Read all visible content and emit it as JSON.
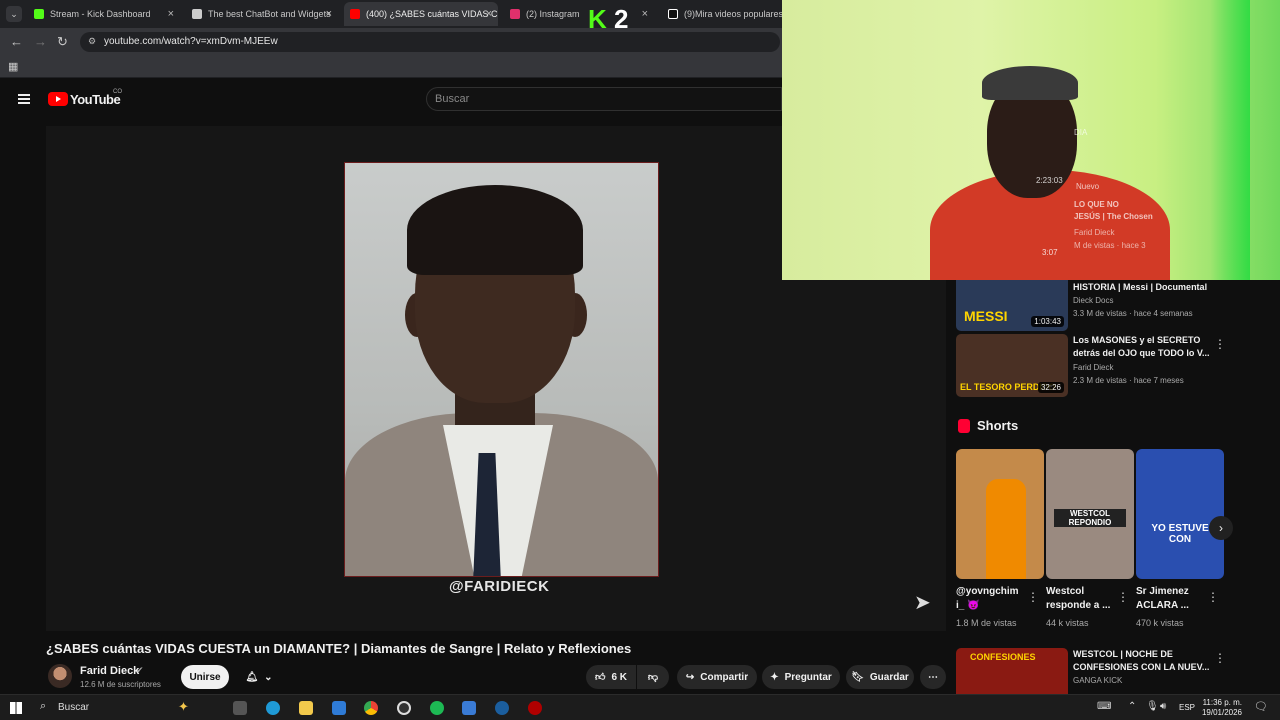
{
  "browser": {
    "tabs": [
      {
        "label": "Stream - Kick Dashboard",
        "color": "#53fc18"
      },
      {
        "label": "The best ChatBot and Widgets",
        "color": "#cccccc"
      },
      {
        "label": "(400) ¿SABES cuántas VIDAS C",
        "color": "#ff0000"
      },
      {
        "label": "(2) Instagram",
        "color": "#e1306c"
      },
      {
        "label": "(9)Mira videos populares sel",
        "color": "#ffffff"
      }
    ],
    "url": "youtube.com/watch?v=xmDvm-MJEEw"
  },
  "youtube": {
    "logo_text": "YouTube",
    "country_code": "CO",
    "search_placeholder": "Buscar"
  },
  "player": {
    "watermark": "@FARIDIECK"
  },
  "video": {
    "title": "¿SABES cuántas VIDAS CUESTA un DIAMANTE? | Diamantes de Sangre | Relato y Reflexiones",
    "channel": "Farid Dieck",
    "subscribers": "12.6 M de suscriptores",
    "join_label": "Unirse",
    "like_count": "6 K",
    "share_label": "Compartir",
    "ask_label": "Preguntar",
    "save_label": "Guardar"
  },
  "related": [
    {
      "title": "El JUGADOR que CAMBIÓ LA HISTORIA | Messi | Documental",
      "channel": "Dieck Docs",
      "meta": "3.3 M de vistas · hace 4 semanas",
      "duration": "1:03:43",
      "thumb_text": "MESSI",
      "thumb_color": "#2a3a58"
    },
    {
      "title": "Los MASONES y el SECRETO detrás del OJO que TODO lo V...",
      "channel": "Farid Dieck",
      "meta": "2.3 M de vistas · hace 7 meses",
      "duration": "32:26",
      "thumb_text": "EL TESORO PERDIDO",
      "thumb_color": "#4a3024"
    },
    {
      "title": "WESTCOL | NOCHE DE CONFESIONES CON LA NUEV...",
      "channel": "GANGA KICK",
      "meta": "",
      "duration": "",
      "thumb_text": "CONFESIONES",
      "thumb_color": "#8a1a12"
    }
  ],
  "shorts": {
    "heading": "Shorts",
    "items": [
      {
        "title": "@yovngchim i_ 😈",
        "views": "1.8 M de vistas",
        "color": "#c48a4a",
        "overlay": ""
      },
      {
        "title": "Westcol responde a ...",
        "views": "44 k vistas",
        "color": "#9a8a80",
        "overlay": "WESTCOL REPONDIO"
      },
      {
        "title": "Sr Jimenez ACLARA ...",
        "views": "470 k vistas",
        "color": "#2a4fb0",
        "overlay": "YO ESTUVE CON"
      }
    ]
  },
  "webcam": {
    "badge": "2",
    "overlay_lines": [
      "DIA",
      "2:23:03",
      "Nuevo",
      "LO QUE NO",
      "JESÚS | The Chosen",
      "Farid Dieck",
      "M de vistas · hace 3",
      "3:07"
    ]
  },
  "taskbar": {
    "search_label": "Buscar",
    "lang": "ESP",
    "time": "11:36 p. m.",
    "date": "19/01/2026"
  }
}
